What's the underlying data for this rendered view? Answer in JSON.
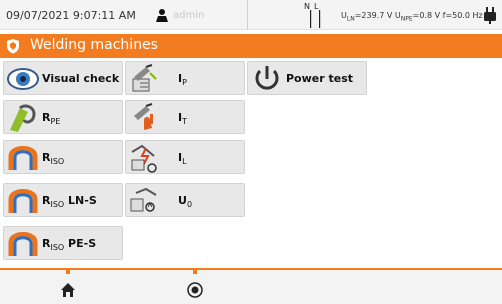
{
  "status": {
    "datetime": "09/07/2021 9:07:11 AM",
    "user": "admin",
    "nl_label_n": "N",
    "nl_label_l": "L",
    "uln_value": "=239.7 V",
    "unpe_value": "=0.8 V",
    "freq": "f=50.0 Hz",
    "uln_label": "U",
    "uln_sub": "LN",
    "unpe_label": "U",
    "unpe_sub": "NPE"
  },
  "title": {
    "text": "Welding machines",
    "icon": "shield-icon"
  },
  "tests": [
    {
      "id": "visual-check",
      "label": "Visual check",
      "sub": "",
      "icon": "eye-icon"
    },
    {
      "id": "ip",
      "label": "I",
      "sub": "P",
      "icon": "welder-probe-icon"
    },
    {
      "id": "power-test",
      "label": "Power test",
      "sub": "",
      "icon": "power-icon"
    },
    {
      "id": "rpe",
      "label": "R",
      "sub": "PE",
      "icon": "clamp-icon"
    },
    {
      "id": "it",
      "label": "I",
      "sub": "T",
      "icon": "welder-hand-icon"
    },
    {
      "id": "riso",
      "label": "R",
      "sub": "ISO",
      "icon": "insulation-icon"
    },
    {
      "id": "il",
      "label": "I",
      "sub": "L",
      "icon": "leakage-icon"
    },
    {
      "id": "riso-ln-s",
      "label": "R",
      "sub": "ISO",
      "suffix": " LN-S",
      "icon": "insulation-icon"
    },
    {
      "id": "u0",
      "label": "U",
      "sub": "0",
      "icon": "voltage-icon"
    },
    {
      "id": "riso-pe-s",
      "label": "R",
      "sub": "ISO",
      "suffix": " PE-S",
      "icon": "insulation-icon"
    }
  ],
  "bottom": {
    "home_icon": "home-icon",
    "menu_icon": "menu-circle-icon"
  },
  "colors": {
    "accent": "#f47c20",
    "button_bg": "#e8e8e8",
    "button_border": "#d3d3d3"
  }
}
